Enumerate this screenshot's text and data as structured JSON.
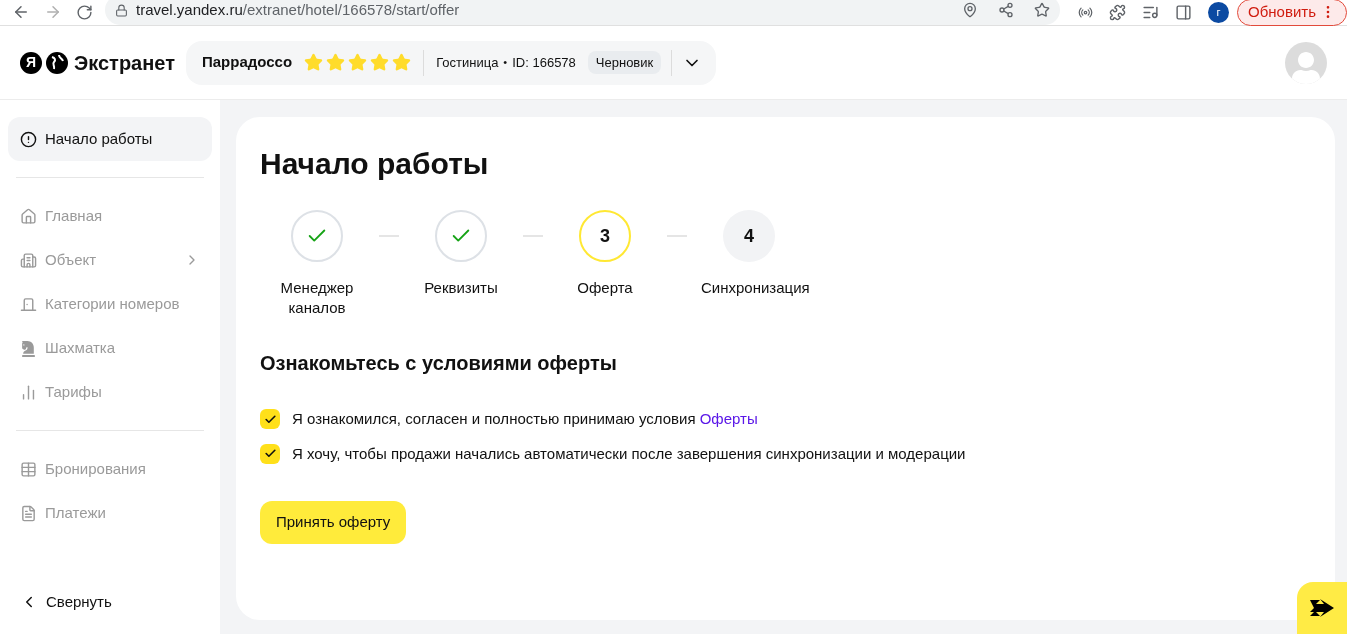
{
  "browser": {
    "url": {
      "host": "travel.yandex.ru",
      "path": "/extranet/hotel/166578/start/offer"
    },
    "profile_initial": "г",
    "update_button": "Обновить"
  },
  "header": {
    "logo_letter": "Я",
    "logo_text": "Экстранет",
    "hotel_name": "Паррадоссо",
    "stars": 5,
    "hotel_type": "Гостиница",
    "separator": "•",
    "hotel_id": "ID: 166578",
    "status": "Черновик"
  },
  "sidebar": {
    "groups": [
      [
        {
          "label": "Начало работы",
          "kind": "alert",
          "selected": true,
          "disabled": false,
          "has_submenu": false
        }
      ],
      [
        {
          "label": "Главная",
          "kind": "home",
          "selected": false,
          "disabled": true,
          "has_submenu": false
        },
        {
          "label": "Объект",
          "kind": "building",
          "selected": false,
          "disabled": true,
          "has_submenu": true
        },
        {
          "label": "Категории номеров",
          "kind": "door",
          "selected": false,
          "disabled": true,
          "has_submenu": false
        },
        {
          "label": "Шахматка",
          "kind": "chess",
          "selected": false,
          "disabled": true,
          "has_submenu": false
        },
        {
          "label": "Тарифы",
          "kind": "bars",
          "selected": false,
          "disabled": true,
          "has_submenu": false
        }
      ],
      [
        {
          "label": "Бронирования",
          "kind": "table",
          "selected": false,
          "disabled": true,
          "has_submenu": false
        },
        {
          "label": "Платежи",
          "kind": "doc",
          "selected": false,
          "disabled": true,
          "has_submenu": false
        }
      ]
    ],
    "collapse": "Свернуть"
  },
  "page": {
    "title": "Начало работы",
    "steps": [
      {
        "kind": "done",
        "label": "Менеджер каналов"
      },
      {
        "kind": "done",
        "label": "Реквизиты"
      },
      {
        "kind": "current",
        "number": "3",
        "label": "Оферта"
      },
      {
        "kind": "pending",
        "number": "4",
        "label": "Синхронизация"
      }
    ],
    "section_title": "Ознакомьтесь с условиями оферты",
    "agreements": [
      {
        "text": "Я ознакомился, согласен и полностью принимаю условия",
        "link": "Оферты",
        "checked": true
      },
      {
        "text": "Я хочу, чтобы продажи начались автоматически после завершения синхронизации и модерации",
        "checked": true
      }
    ],
    "accept_button": "Принять оферту"
  }
}
